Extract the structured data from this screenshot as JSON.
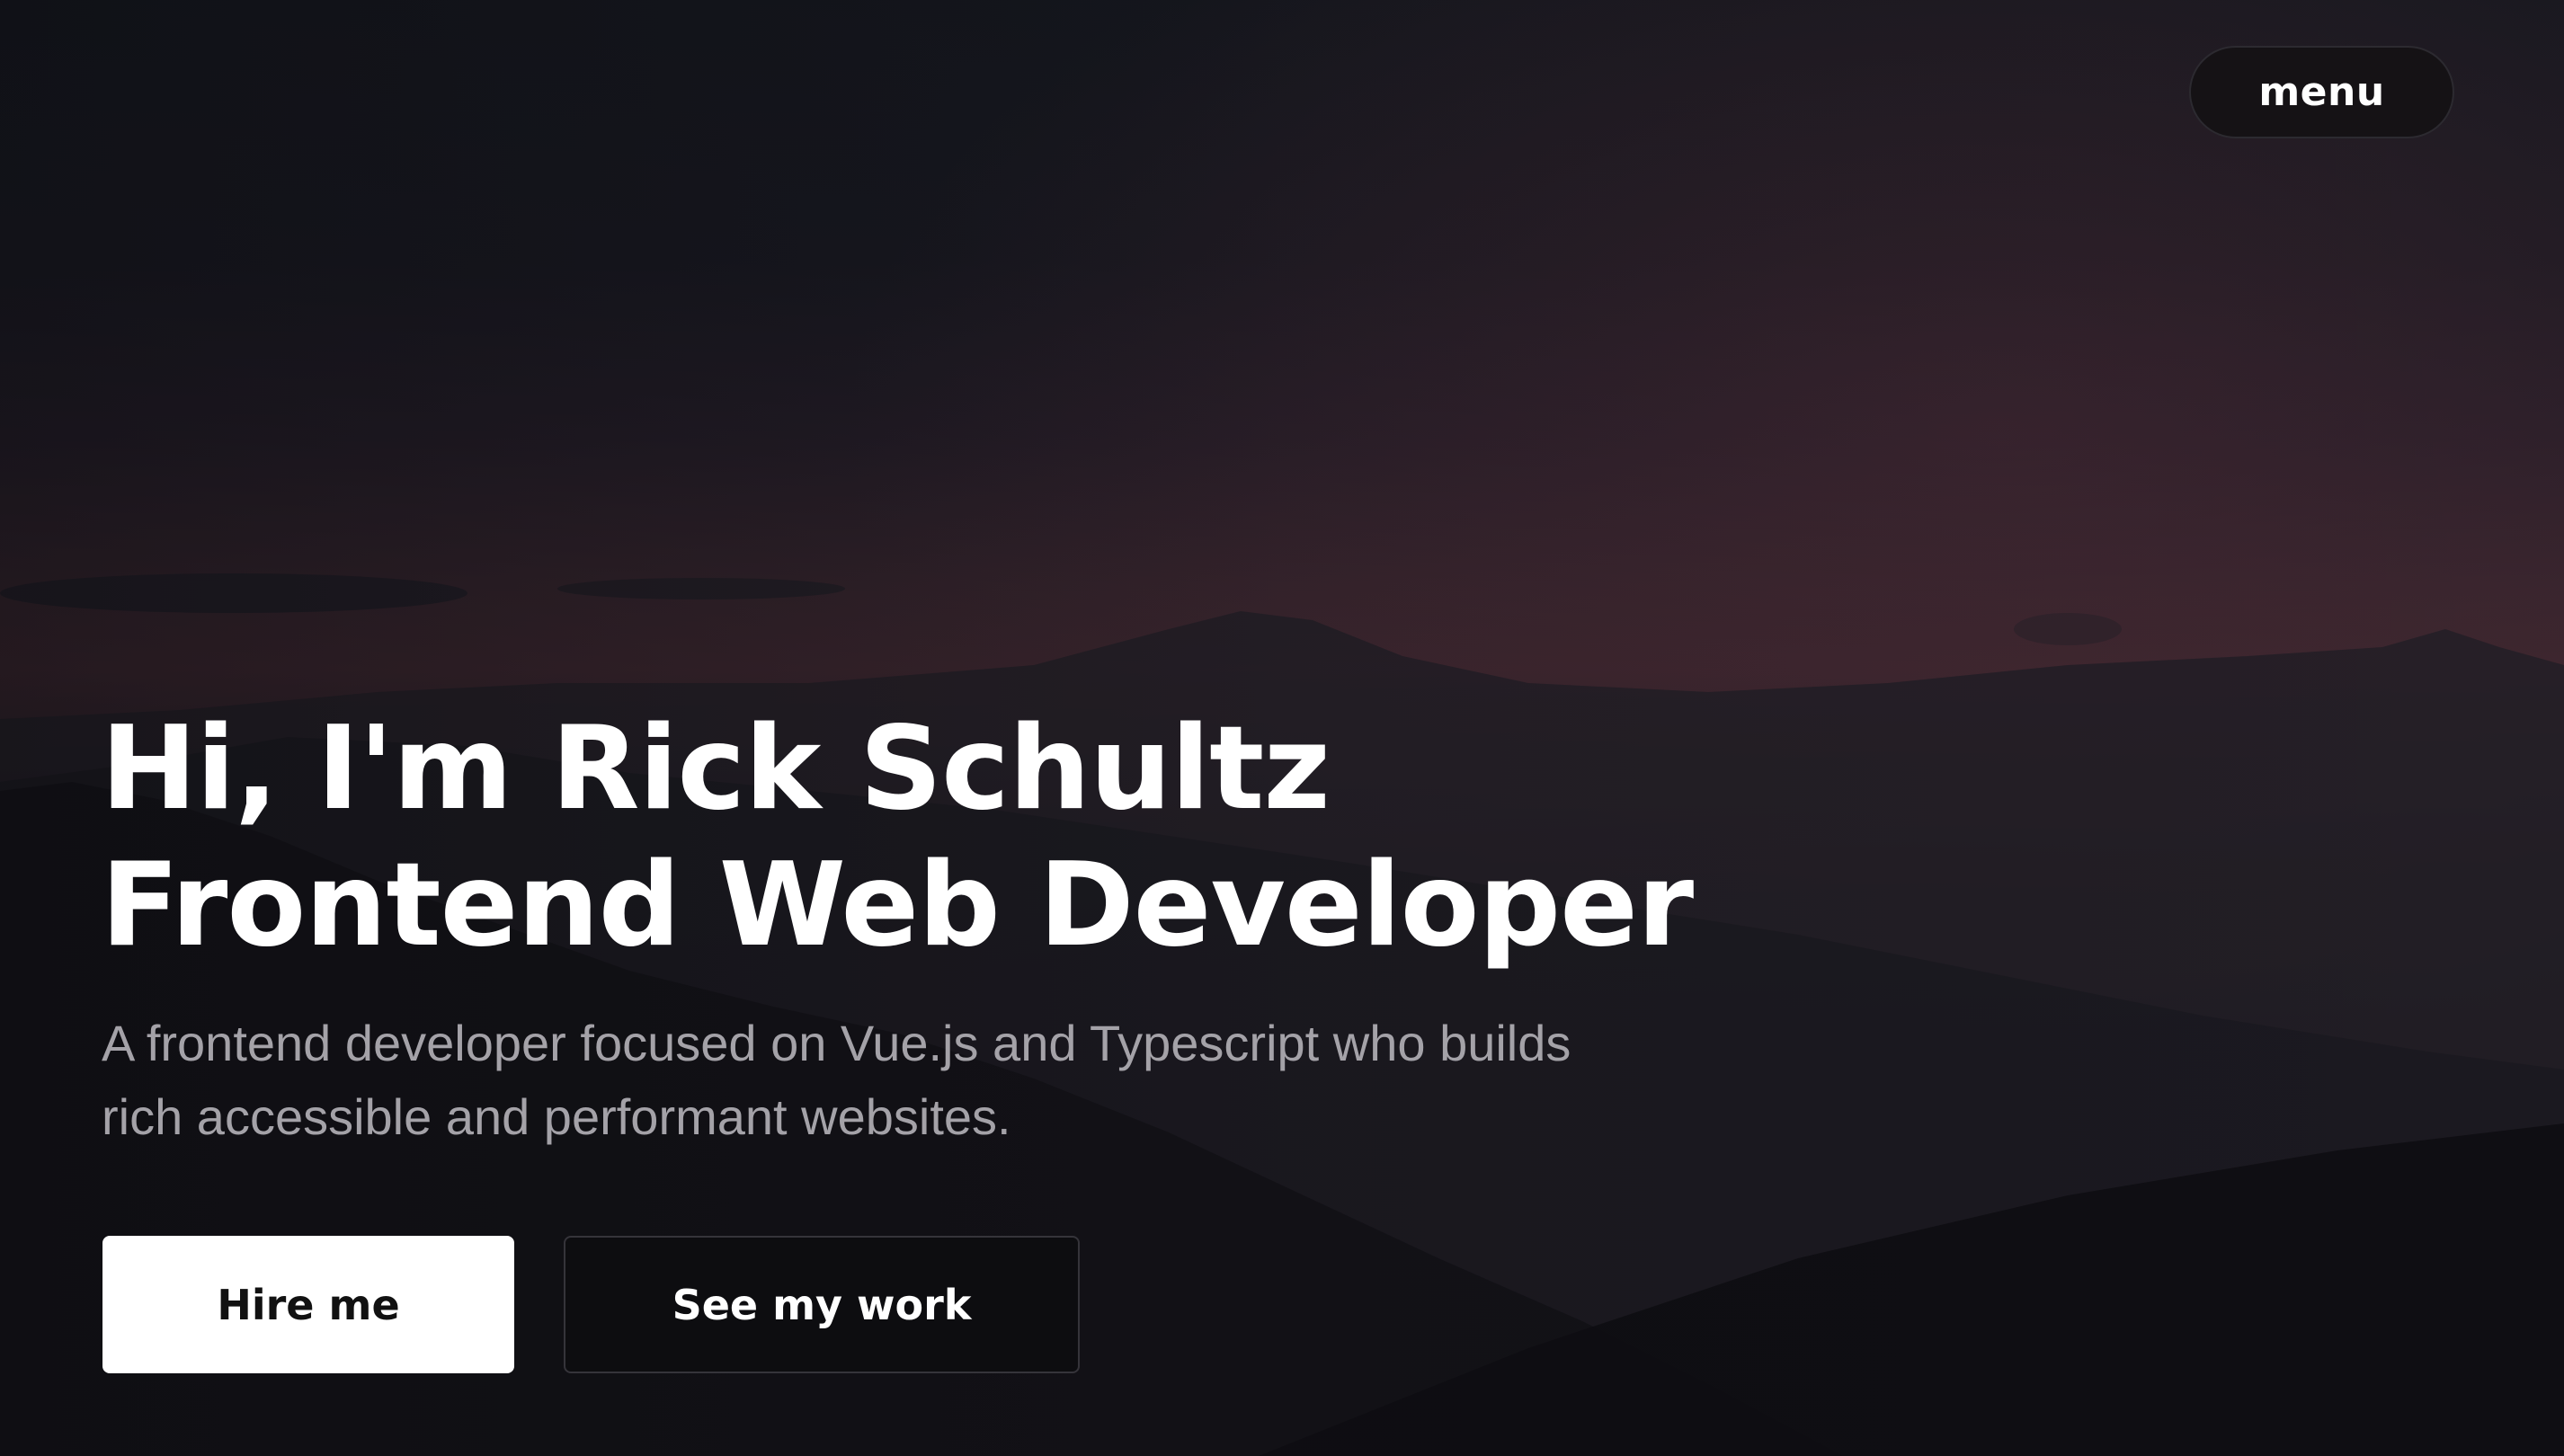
{
  "nav": {
    "menu_label": "menu"
  },
  "hero": {
    "heading_line1": "Hi, I'm Rick Schultz",
    "heading_line2": "Frontend Web Developer",
    "description": "A frontend developer focused on Vue.js and Typescript who builds rich accessible and performant websites.",
    "primary_cta": "Hire me",
    "secondary_cta": "See my work"
  },
  "colors": {
    "text_primary": "#ffffff",
    "text_muted": "#a4a2a8",
    "primary_button_bg": "#ffffff",
    "secondary_button_bg": "#0d0d10",
    "sky_dark": "#14161f",
    "sky_glow": "#40272f"
  }
}
